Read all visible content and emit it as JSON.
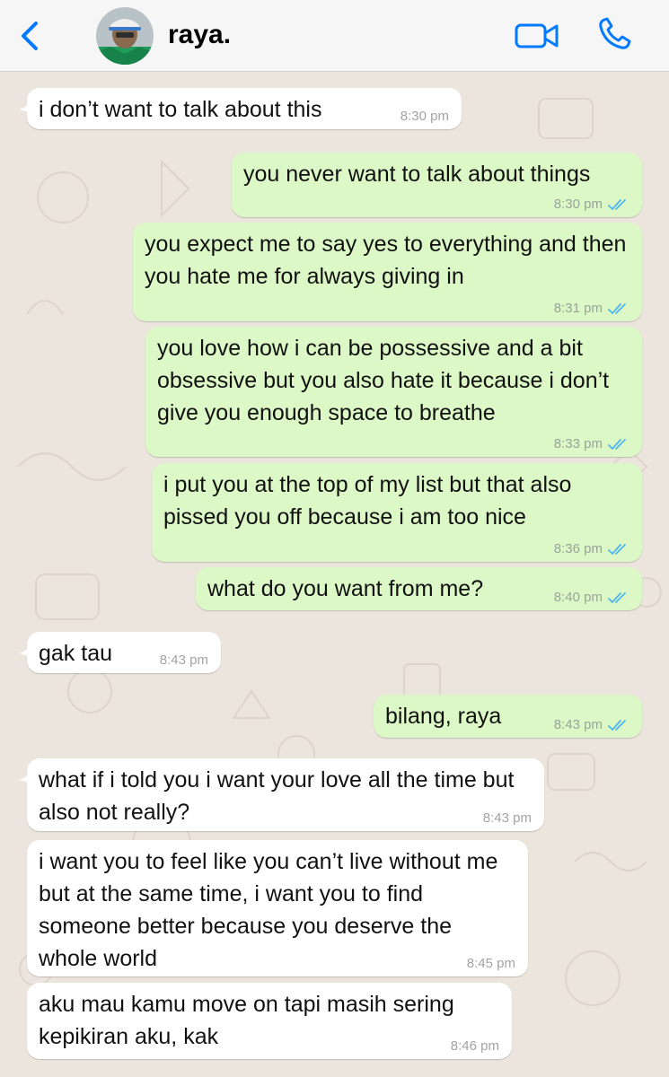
{
  "header": {
    "contact_name": "raya.",
    "back_icon": "chevron-left-icon",
    "video_icon": "video-camera-icon",
    "phone_icon": "phone-icon",
    "accent_color": "#007AFF"
  },
  "messages": [
    {
      "direction": "incoming",
      "text": "i don’t want to talk about this",
      "time": "8:30 pm"
    },
    {
      "direction": "outgoing",
      "text": "you never want to talk about things",
      "time": "8:30 pm",
      "status": "read"
    },
    {
      "direction": "outgoing",
      "text": "you expect me to say yes to everything and then you hate me for always giving in",
      "time": "8:31 pm",
      "status": "read"
    },
    {
      "direction": "outgoing",
      "text": "you love how i can be possessive and a bit obsessive but you also hate it because i don’t give you enough space to breathe",
      "time": "8:33 pm",
      "status": "read"
    },
    {
      "direction": "outgoing",
      "text": "i put you at the top of my list but that also pissed you off because i am too nice",
      "time": "8:36 pm",
      "status": "read"
    },
    {
      "direction": "outgoing",
      "text": "what do you want from me?",
      "time": "8:40 pm",
      "status": "read"
    },
    {
      "direction": "incoming",
      "text": "gak tau",
      "time": "8:43 pm"
    },
    {
      "direction": "outgoing",
      "text": "bilang, raya",
      "time": "8:43 pm",
      "status": "read"
    },
    {
      "direction": "incoming",
      "text": "what if i told you i want your love all the time but also not really?",
      "time": "8:43 pm"
    },
    {
      "direction": "incoming",
      "text": "i want you to feel like you can’t live without me but at the same time, i want you to find someone better because you deserve the whole world",
      "time": "8:45 pm"
    },
    {
      "direction": "incoming",
      "text": "aku mau kamu move on tapi masih sering kepikiran aku, kak",
      "time": "8:46 pm"
    }
  ],
  "colors": {
    "incoming_bubble": "#FFFFFF",
    "outgoing_bubble": "#DCF8C6",
    "read_ticks": "#4FB6EC",
    "chat_background": "#ECE5DD"
  }
}
